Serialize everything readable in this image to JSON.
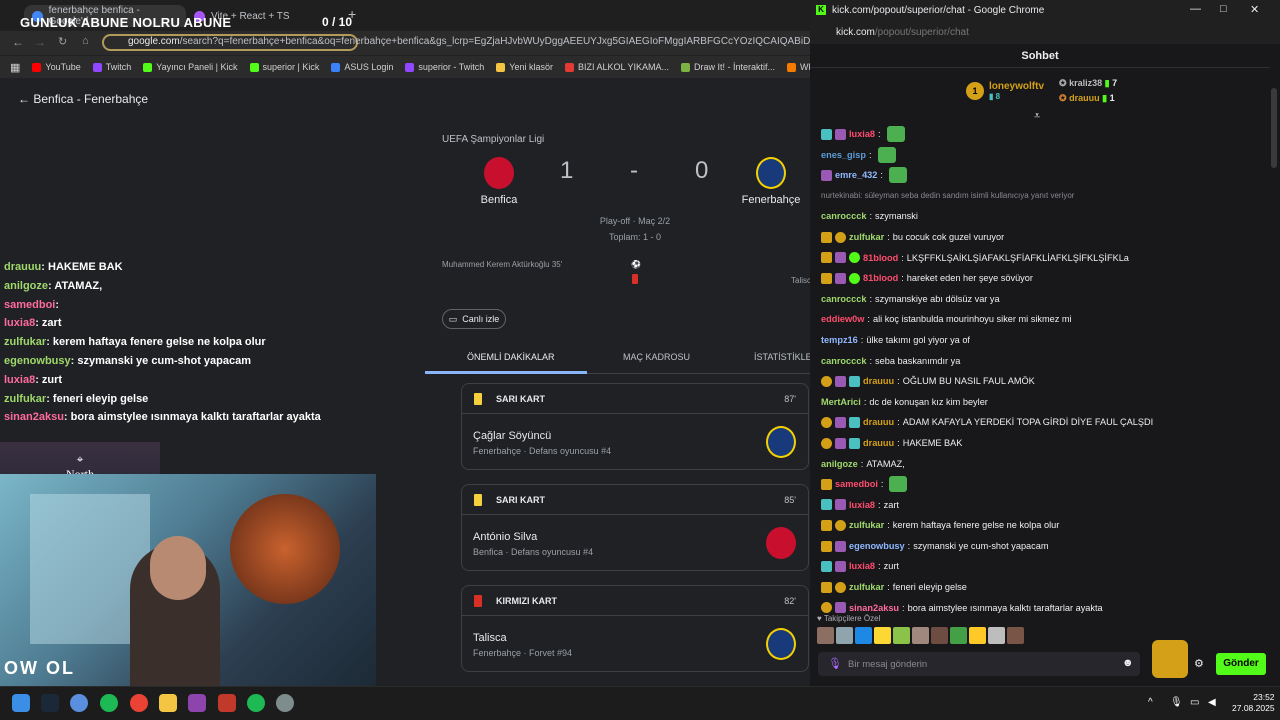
{
  "browser": {
    "tabs": [
      {
        "label": "fenerbahçe benfica - Google'd"
      },
      {
        "label": "Vite + React + TS"
      }
    ],
    "new_tab_label": "+",
    "address_visible": "google.com",
    "address_rest": "/search?q=fenerbahçe+benfica&oq=fenerbahçe+benfica&gs_lcrp=EgZjaHJvbWUyDggAEEUYJxg5GIAEGIoFMggIARBFGCcYOzIQCAIQABiDARixAxiABBiKBTIH",
    "bookmarks": [
      "YouTube",
      "Twitch",
      "Yayıncı Paneli | Kick",
      "superior | Kick",
      "ASUS Login",
      "superior - Twitch",
      "Yeni klasör",
      "BIZI ALKOL YIKAMA...",
      "Draw It! - İnteraktif...",
      "Wheel of Names"
    ],
    "bookmark_colors": [
      "#ff0000",
      "#9146ff",
      "#53fc18",
      "#53fc18",
      "#3b82f6",
      "#9146ff",
      "#f4c542",
      "#e53935",
      "#7cb342",
      "#f57c00"
    ]
  },
  "overlay": {
    "title": "GUNLUK ABUNE NOLRU ABUNE",
    "count": "0  / 10"
  },
  "match": {
    "back_label": "Benfica - Fenerbahçe",
    "league": "UEFA Şampiyonlar Ligi",
    "home": {
      "name": "Benfica",
      "score": "1"
    },
    "away": {
      "name": "Fenerbahçe",
      "score": "0"
    },
    "separator": "-",
    "phase": "Play-off · Maç 2/2",
    "aggregate": "Toplam: 1 - 0",
    "scorer": "Muhammed Kerem Aktürkoğlu 35'",
    "other_event": "Talisc",
    "live_button": "Canlı izle",
    "tabs": [
      "ÖNEMLİ DAKİKALAR",
      "MAÇ KADROSU",
      "İSTATİSTİKLER"
    ],
    "events": [
      {
        "type": "SARI KART",
        "minute": "87'",
        "player": "Çağlar Söyüncü",
        "detail": "Fenerbahçe · Defans oyuncusu #4",
        "team": "fener",
        "color": "#f4d03f"
      },
      {
        "type": "SARI KART",
        "minute": "85'",
        "player": "António Silva",
        "detail": "Benfica · Defans oyuncusu #4",
        "team": "benf",
        "color": "#f4d03f"
      },
      {
        "type": "KIRMIZI KART",
        "minute": "82'",
        "player": "Talisca",
        "detail": "Fenerbahçe · Forvet #94",
        "team": "fener",
        "color": "#d93025"
      }
    ]
  },
  "stream_overlay": {
    "lines": [
      {
        "user": "drauuu",
        "text": "HAKEME BAK",
        "style": "u"
      },
      {
        "user": "anilgoze",
        "text": "ATAMAZ,",
        "style": "u"
      },
      {
        "user": "samedboi",
        "text": "",
        "style": "r"
      },
      {
        "user": "luxia8",
        "text": "zart",
        "style": "r"
      },
      {
        "user": "zulfukar",
        "text": "kerem haftaya fenere gelse ne kolpa olur",
        "style": "u"
      },
      {
        "user": "egenowbusy",
        "text": "szymanski ye cum-shot yapacam",
        "style": "u"
      },
      {
        "user": "luxia8",
        "text": "zurt",
        "style": "r"
      },
      {
        "user": "zulfukar",
        "text": "feneri eleyip gelse",
        "style": "u"
      },
      {
        "user": "sinan2aksu",
        "text": "bora aimstylee ısınmaya kalktı taraftarlar ayakta",
        "style": "r"
      }
    ],
    "north_label": "North",
    "cam_text": "OW OL"
  },
  "chat_window": {
    "title": "kick.com/popout/superior/chat - Google Chrome",
    "url_host": "kick.com",
    "url_path": "/popout/superior/chat",
    "header": "Sohbet",
    "top_gifter": {
      "rank": "1",
      "name": "loneywolftv",
      "count": "8"
    },
    "gifters": [
      {
        "name": "kraliz38",
        "count": "7"
      },
      {
        "name": "drauuu",
        "count": "1"
      }
    ],
    "messages": [
      {
        "badges": [
          "sub",
          "bot"
        ],
        "user": "luxia8",
        "color": "#ff4d6d",
        "text": "",
        "emote": true
      },
      {
        "badges": [],
        "user": "enes_gisp",
        "color": "#5b9bd5",
        "text": "",
        "emote": true
      },
      {
        "badges": [
          "bot"
        ],
        "user": "emre_432",
        "color": "#8fb8ff",
        "text": "",
        "emote": true
      },
      {
        "reply": true,
        "text": "nurtekinabi: süleyman seba dedin sandım isimli kullanıcıya yanıt veriyor"
      },
      {
        "badges": [],
        "user": "canroccck",
        "color": "#9fd86b",
        "text": "szymanski"
      },
      {
        "badges": [
          "crown",
          "medal"
        ],
        "user": "zulfukar",
        "color": "#9fd86b",
        "text": "bu cocuk cok guzel vuruyor"
      },
      {
        "badges": [
          "crown",
          "bot",
          "ver"
        ],
        "user": "81blood",
        "color": "#ff4d6d",
        "text": "LKŞFFKLŞAİKLŞİAFAKLŞFİAFKLİAFKLŞİFKLŞİFKLa"
      },
      {
        "badges": [
          "crown",
          "bot",
          "ver"
        ],
        "user": "81blood",
        "color": "#ff4d6d",
        "text": "hareket eden her şeye sövüyor"
      },
      {
        "badges": [],
        "user": "canroccck",
        "color": "#9fd86b",
        "text": "szymanskiye abı dölsüz var ya"
      },
      {
        "badges": [],
        "user": "eddiew0w",
        "color": "#ff4d6d",
        "text": "ali koç istanbulda mourinhoyu siker mi sikmez mi"
      },
      {
        "badges": [],
        "user": "tempz16",
        "color": "#8fb8ff",
        "text": "ülke takımı gol yiyor ya of"
      },
      {
        "badges": [],
        "user": "canroccck",
        "color": "#9fd86b",
        "text": "seba baskanımdır ya"
      },
      {
        "badges": [
          "medal",
          "bot",
          "sub"
        ],
        "user": "drauuu",
        "color": "#d4a017",
        "text": "OĞLUM BU NASIL FAUL AMÖK"
      },
      {
        "badges": [],
        "user": "MertArici",
        "color": "#9fd86b",
        "text": "dc de konuşan kız kim beyler"
      },
      {
        "badges": [
          "medal",
          "bot",
          "sub"
        ],
        "user": "drauuu",
        "color": "#d4a017",
        "text": "ADAM KAFAYLA YERDEKİ TOPA GİRDİ DİYE FAUL ÇALŞDI"
      },
      {
        "badges": [
          "medal",
          "bot",
          "sub"
        ],
        "user": "drauuu",
        "color": "#d4a017",
        "text": "HAKEME BAK"
      },
      {
        "badges": [],
        "user": "anilgoze",
        "color": "#9fd86b",
        "text": "ATAMAZ,"
      },
      {
        "badges": [
          "crown"
        ],
        "user": "samedboi",
        "color": "#ff4d6d",
        "text": "",
        "emote": true
      },
      {
        "badges": [
          "sub",
          "bot"
        ],
        "user": "luxia8",
        "color": "#ff4d6d",
        "text": "zart"
      },
      {
        "badges": [
          "crown",
          "medal"
        ],
        "user": "zulfukar",
        "color": "#9fd86b",
        "text": "kerem haftaya fenere gelse ne kolpa olur"
      },
      {
        "badges": [
          "crown",
          "bot"
        ],
        "user": "egenowbusy",
        "color": "#8fb8ff",
        "text": "szymanski ye cum-shot yapacam"
      },
      {
        "badges": [
          "sub",
          "bot"
        ],
        "user": "luxia8",
        "color": "#ff4d6d",
        "text": "zurt"
      },
      {
        "badges": [
          "crown",
          "medal"
        ],
        "user": "zulfukar",
        "color": "#9fd86b",
        "text": "feneri eleyip gelse"
      },
      {
        "badges": [
          "medal",
          "bot"
        ],
        "user": "sinan2aksu",
        "color": "#ff6b9d",
        "text": "bora aimstylee ısınmaya kalktı taraftarlar ayakta"
      }
    ],
    "followers_only": "Takipçilere Özel",
    "input_placeholder": "Bir mesaj gönderin",
    "send_label": "Gönder"
  },
  "taskbar": {
    "time": "23:52",
    "date": "27.08.2025"
  }
}
